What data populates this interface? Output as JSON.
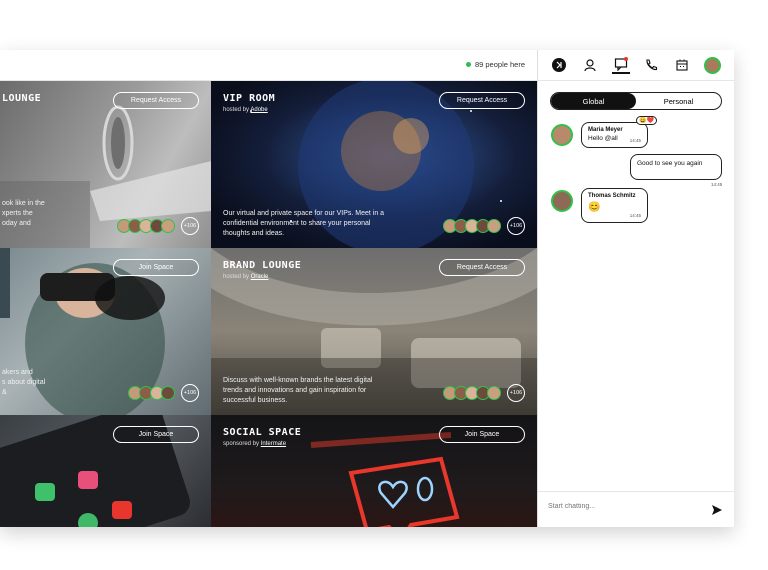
{
  "topbar": {
    "online_text": "89 people here"
  },
  "tiles": [
    {
      "title": "LOUNGE",
      "host_prefix": "",
      "host_link": "",
      "button": "Request Access",
      "desc": "ook like in the\nxperts the\noday and",
      "more": "+106"
    },
    {
      "title": "VIP ROOM",
      "host_prefix": "hosted by",
      "host_link": "Adobe",
      "button": "Request Access",
      "desc": "Our virtual and private space for our VIPs. Meet in a confidential environment to share your personal thoughts and ideas.",
      "more": "+106"
    },
    {
      "title": "",
      "host_prefix": "",
      "host_link": "",
      "button": "Join Space",
      "desc": "akers and\ns about digital\n&",
      "more": "+106"
    },
    {
      "title": "BRAND LOUNGE",
      "host_prefix": "hosted by",
      "host_link": "Oracle",
      "button": "Request Access",
      "desc": "Discuss with well-known brands the latest digital trends and innovations and gain inspiration for successful business.",
      "more": "+106"
    },
    {
      "title": "",
      "host_prefix": "",
      "host_link": "",
      "button": "Join Space",
      "desc": "",
      "more": ""
    },
    {
      "title": "SOCIAL SPACE",
      "host_prefix": "sponsored by",
      "host_link": "Intermate",
      "button": "Join Space",
      "desc": "",
      "more": ""
    }
  ],
  "chat": {
    "tabs": [
      "Global",
      "Personal"
    ],
    "messages": [
      {
        "name": "Maria Meyer",
        "text": "Hello @all",
        "time": "14:45",
        "reactions": "😄❤️"
      },
      {
        "name": "",
        "text": "Good to see you again",
        "time": "14:45"
      },
      {
        "name": "Thomas Schmitz",
        "text": "😊",
        "time": "14:45"
      }
    ],
    "composer_placeholder": "Start chatting..."
  },
  "icons": [
    "collapse-icon",
    "user-icon",
    "chat-icon",
    "phone-icon",
    "calendar-icon",
    "avatar"
  ],
  "colors": {
    "accent_green": "#33c04a",
    "dark": "#111111"
  }
}
